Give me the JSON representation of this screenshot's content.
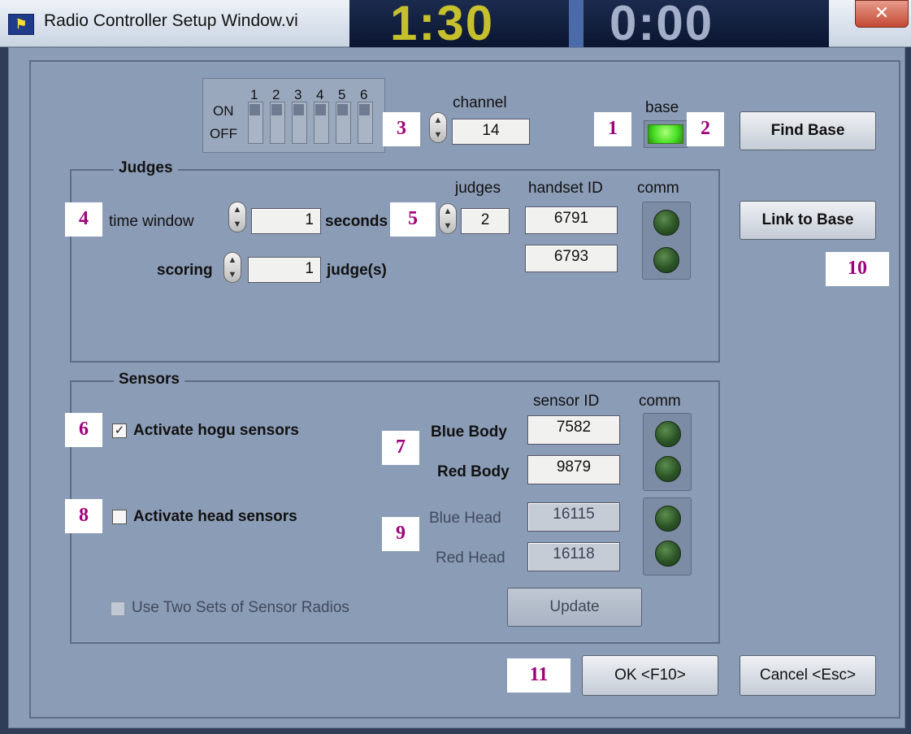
{
  "window": {
    "title": "Radio Controller Setup Window.vi",
    "close_glyph": "✕",
    "app_icon": "flag-icon"
  },
  "background_clock": {
    "primary": "1:30",
    "secondary": "0:00"
  },
  "dip_switch": {
    "on_label": "ON",
    "off_label": "OFF",
    "numbers": [
      "1",
      "2",
      "3",
      "4",
      "5",
      "6"
    ]
  },
  "channel": {
    "label": "channel",
    "value": "14"
  },
  "base": {
    "label": "base",
    "indicator_color": "#44dd22"
  },
  "find_base_button": "Find Base",
  "link_to_base_button": "Link to Base",
  "judges": {
    "title": "Judges",
    "time_window_label": "time window",
    "time_window_value": "1",
    "seconds_label": "seconds",
    "scoring_label": "scoring",
    "scoring_value": "1",
    "judges_unit_label": "judge(s)",
    "judges_label": "judges",
    "judges_value": "2",
    "handset_header": "handset ID",
    "comm_header": "comm",
    "handset_ids": [
      "6791",
      "6793"
    ]
  },
  "sensors": {
    "title": "Sensors",
    "sensor_id_header": "sensor ID",
    "comm_header": "comm",
    "activate_hogu_label": "Activate hogu sensors",
    "activate_hogu_checked": "✓",
    "activate_head_label": "Activate head sensors",
    "blue_body_label": "Blue Body",
    "blue_body_id": "7582",
    "red_body_label": "Red Body",
    "red_body_id": "9879",
    "blue_head_label": "Blue Head",
    "blue_head_id": "16115",
    "red_head_label": "Red Head",
    "red_head_id": "16118",
    "two_sets_label": "Use Two Sets of Sensor Radios",
    "update_button": "Update"
  },
  "ok_button": "OK <F10>",
  "cancel_button": "Cancel <Esc>",
  "markers": [
    "1",
    "2",
    "3",
    "4",
    "5",
    "6",
    "7",
    "8",
    "9",
    "10",
    "11"
  ]
}
